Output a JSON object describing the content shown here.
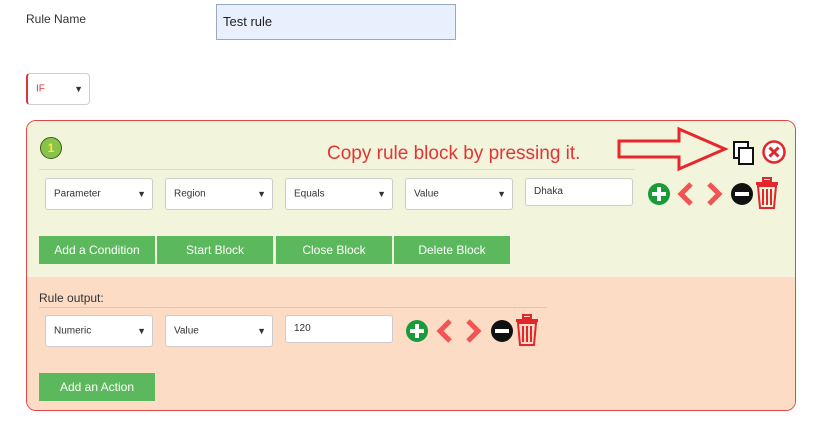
{
  "rule_name": {
    "label": "Rule Name",
    "value": "Test  rule"
  },
  "if_select": {
    "value": "IF"
  },
  "block": {
    "number": "1",
    "hint": "Copy rule block by pressing it.",
    "condition": {
      "parameter": "Parameter",
      "field": "Region",
      "operator": "Equals",
      "value_type": "Value",
      "value": "Dhaka"
    },
    "buttons": {
      "add_condition": "Add a Condition",
      "start_block": "Start Block",
      "close_block": "Close Block",
      "delete_block": "Delete Block"
    },
    "output": {
      "label": "Rule output:",
      "type": "Numeric",
      "value_type": "Value",
      "value": "120",
      "add_action": "Add an Action"
    }
  },
  "colors": {
    "condition_bg": "#f2f4dc",
    "output_bg": "#fddcc5",
    "button_green": "#5cb85c",
    "accent_red": "#e43535"
  },
  "icons": [
    "copy-icon",
    "close-circle-icon",
    "plus-circle-icon",
    "chevron-left-icon",
    "chevron-right-icon",
    "minus-circle-icon",
    "trash-icon",
    "arrow-right-icon"
  ]
}
